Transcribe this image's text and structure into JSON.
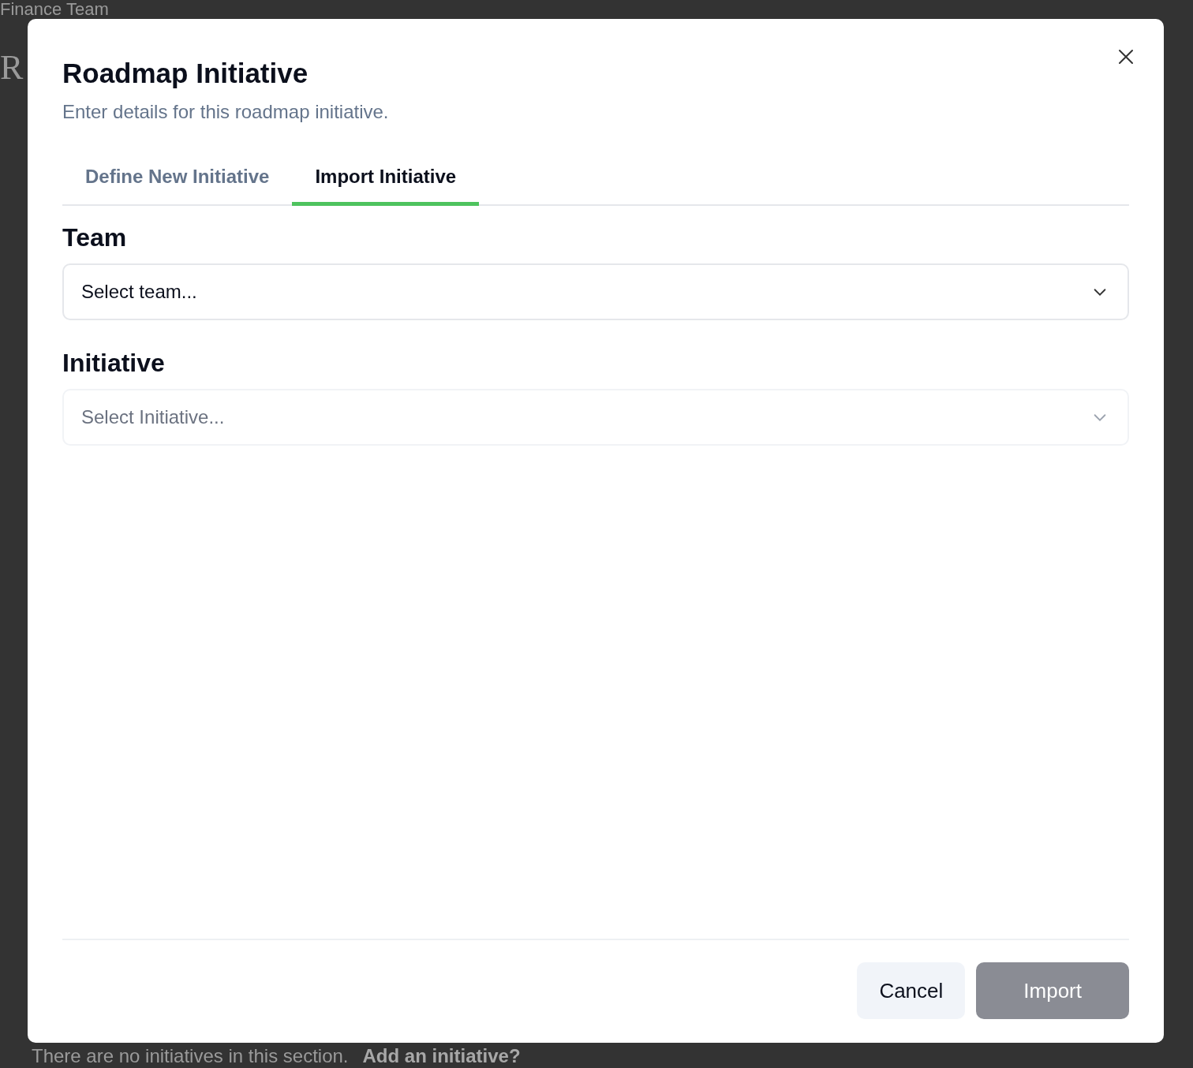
{
  "background_page": {
    "team_title": "Finance Team",
    "heading": "R",
    "empty_message": "There are no initiatives in this section.",
    "add_link": "Add an initiative?"
  },
  "dialog": {
    "title": "Roadmap Initiative",
    "subtitle": "Enter details for this roadmap initiative.",
    "tabs": [
      {
        "label": "Define New Initiative",
        "selected": false
      },
      {
        "label": "Import Initiative",
        "selected": true
      }
    ],
    "fields": [
      {
        "label": "Team",
        "placeholder": "Select team...",
        "disabled": false
      },
      {
        "label": "Initiative",
        "placeholder": "Select Initiative...",
        "disabled": true
      }
    ],
    "buttons": [
      {
        "label": "Cancel",
        "kind": "secondary",
        "disabled": false
      },
      {
        "label": "Import",
        "kind": "primary",
        "disabled": true
      }
    ]
  }
}
